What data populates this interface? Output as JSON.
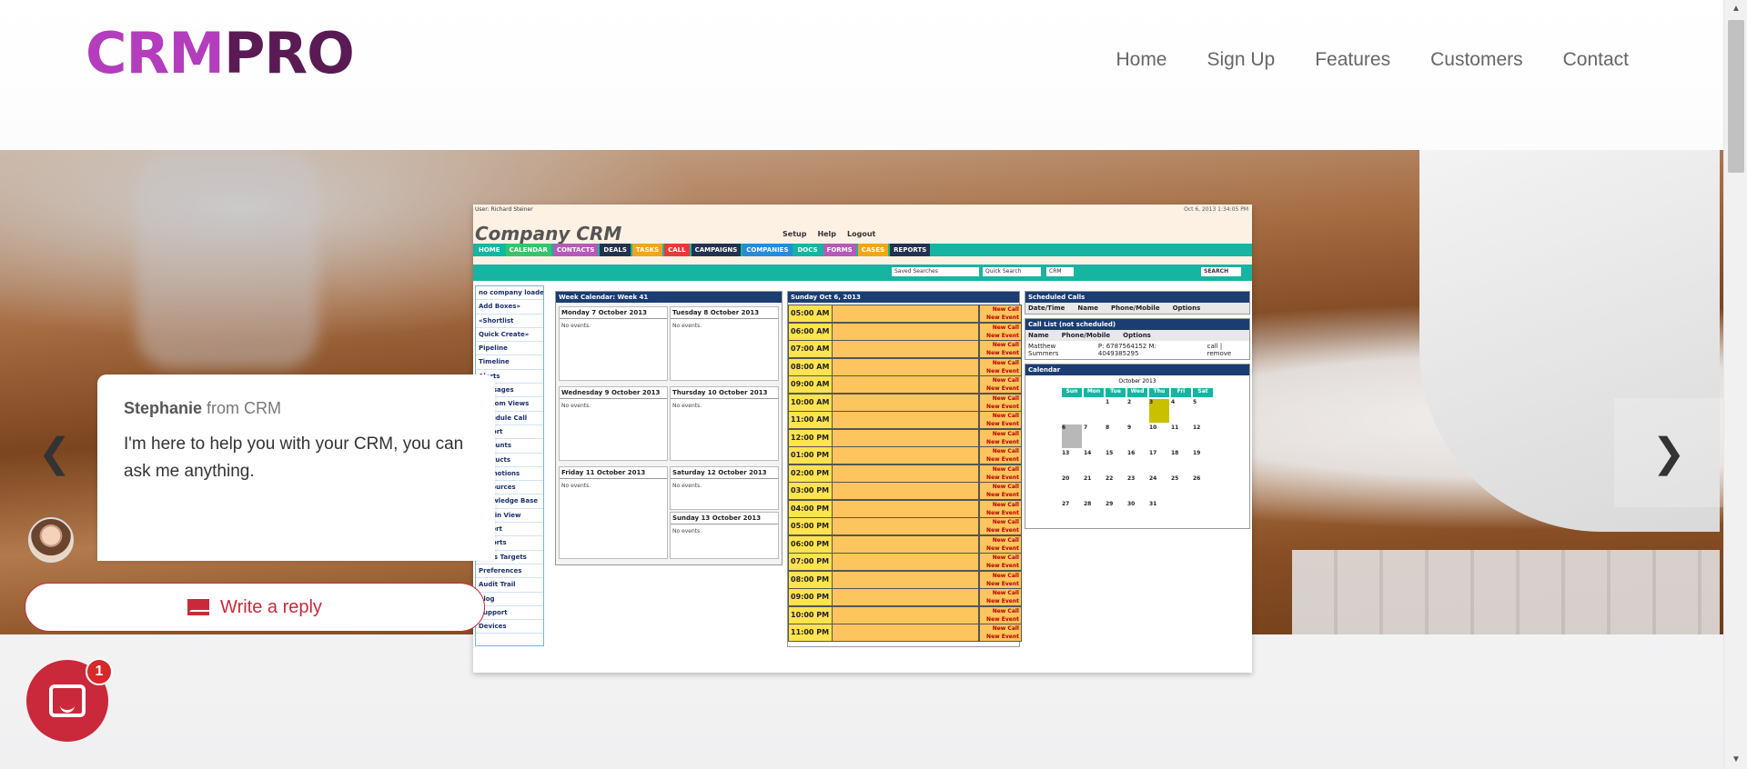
{
  "header": {
    "logo_part1": "CRM",
    "logo_part2": "PRO",
    "nav": [
      "Home",
      "Sign Up",
      "Features",
      "Customers",
      "Contact"
    ]
  },
  "carousel": {
    "prev_icon": "chevron-left-icon",
    "next_icon": "chevron-right-icon"
  },
  "crm_screenshot": {
    "user": "User: Richard Steiner",
    "date": "Oct 6, 2013 1:34:05 PM",
    "brand": "Company CRM",
    "tools": [
      "Setup",
      "Help",
      "Logout"
    ],
    "menu": [
      "HOME",
      "CALENDAR",
      "CONTACTS",
      "DEALS",
      "TASKS",
      "CALL",
      "CAMPAIGNS",
      "COMPANIES",
      "DOCS",
      "FORMS",
      "CASES",
      "REPORTS"
    ],
    "search": {
      "saved": "Saved Searches",
      "quick": "Quick Search",
      "mode": "CRM",
      "button": "SEARCH"
    },
    "left_menu": [
      "no company loaded",
      "Add Boxes»",
      "«Shortlist",
      "Quick Create»",
      "Pipeline",
      "Timeline",
      "Alerts",
      "Messages",
      "Custom Views",
      "Schedule Call",
      "Import",
      "Accounts",
      "Products",
      "Promotions",
      "Resources",
      "Knowledge Base",
      "Admin View",
      "Export",
      "Imports",
      "Sales Targets",
      "Preferences",
      "Audit Trail",
      "Blog",
      "Support",
      "Devices"
    ],
    "week_title": "Week Calendar: Week 41",
    "days": [
      {
        "label": "Monday 7 October 2013",
        "note": "No events."
      },
      {
        "label": "Tuesday 8 October 2013",
        "note": "No events."
      },
      {
        "label": "Wednesday 9 October 2013",
        "note": "No events."
      },
      {
        "label": "Thursday 10 October 2013",
        "note": "No events."
      },
      {
        "label": "Friday 11 October 2013",
        "note": "No events."
      },
      {
        "label": "Saturday 12 October 2013",
        "note": "No events."
      },
      {
        "label": "Sunday 13 October 2013",
        "note": "No events."
      }
    ],
    "day_title": "Sunday Oct 6, 2013",
    "hours": [
      "05:00 AM",
      "06:00 AM",
      "07:00 AM",
      "08:00 AM",
      "09:00 AM",
      "10:00 AM",
      "11:00 AM",
      "12:00 PM",
      "01:00 PM",
      "02:00 PM",
      "03:00 PM",
      "04:00 PM",
      "05:00 PM",
      "06:00 PM",
      "07:00 PM",
      "08:00 PM",
      "09:00 PM",
      "10:00 PM",
      "11:00 PM"
    ],
    "new_call": "New Call",
    "new_event": "New Event",
    "scheduled_title": "Scheduled Calls",
    "scheduled_cols": [
      "Date/Time",
      "Name",
      "Phone/Mobile",
      "Options"
    ],
    "calllist_title": "Call List (not scheduled)",
    "calllist_cols": [
      "Name",
      "Phone/Mobile",
      "Options"
    ],
    "calllist_row": {
      "name": "Matthew Summers",
      "phone": "P: 6787564152 M: 4049385295",
      "options": "call | remove"
    },
    "calendar_title": "Calendar",
    "cal_month": "October",
    "cal_year": "2013",
    "cal_days": [
      "Sun",
      "Mon",
      "Tue",
      "Wed",
      "Thu",
      "Fri",
      "Sat"
    ],
    "cal_dates": [
      "",
      "",
      "1",
      "2",
      "3",
      "4",
      "5",
      "6",
      "7",
      "8",
      "9",
      "10",
      "11",
      "12",
      "13",
      "14",
      "15",
      "16",
      "17",
      "18",
      "19",
      "20",
      "21",
      "22",
      "23",
      "24",
      "25",
      "26",
      "27",
      "28",
      "29",
      "30",
      "31",
      "",
      ""
    ]
  },
  "chat": {
    "agent_name": "Stephanie",
    "from_text": "from CRM",
    "message": "I'm here to help you with your CRM, you can ask me anything.",
    "reply_label": "Write a reply",
    "badge_count": "1"
  }
}
